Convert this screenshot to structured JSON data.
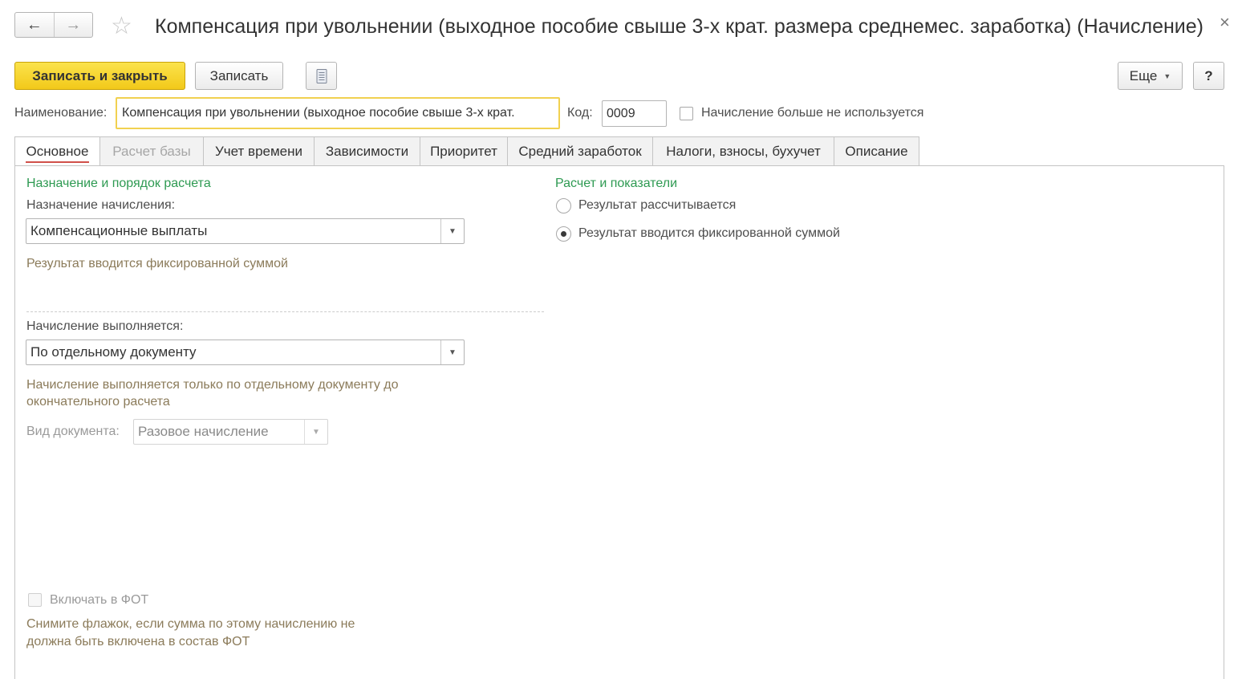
{
  "header": {
    "title": "Компенсация при увольнении (выходное пособие свыше 3-х крат. размера среднемес. заработка) (Начисление)",
    "back_icon": "←",
    "forward_icon": "→",
    "favorite_icon": "☆",
    "close_icon": "×"
  },
  "toolbar": {
    "save_close_label": "Записать и закрыть",
    "save_label": "Записать",
    "more_label": "Еще",
    "help_label": "?"
  },
  "fields": {
    "name_label": "Наименование:",
    "name_value": "Компенсация при увольнении (выходное пособие свыше 3-х крат.",
    "code_label": "Код:",
    "code_value": "0009",
    "unused_label": "Начисление больше не используется"
  },
  "tabs": [
    {
      "label": "Основное"
    },
    {
      "label": "Расчет базы"
    },
    {
      "label": "Учет времени"
    },
    {
      "label": "Зависимости"
    },
    {
      "label": "Приоритет"
    },
    {
      "label": "Средний заработок"
    },
    {
      "label": "Налоги, взносы, бухучет"
    },
    {
      "label": "Описание"
    }
  ],
  "main": {
    "group_left_title": "Назначение и порядок расчета",
    "purpose_label": "Назначение начисления:",
    "purpose_value": "Компенсационные выплаты",
    "purpose_note": "Результат вводится фиксированной суммой",
    "execution_label": "Начисление выполняется:",
    "execution_value": "По отдельному документу",
    "execution_note_line1": "Начисление выполняется только по отдельному документу до",
    "execution_note_line2": "окончательного расчета",
    "doc_type_label": "Вид документа:",
    "doc_type_value": "Разовое начисление",
    "include_fot_label": "Включать в ФОТ",
    "fot_note_line1": "Снимите флажок, если сумма по этому начислению не",
    "fot_note_line2": "должна быть включена в состав ФОТ",
    "group_right_title": "Расчет и показатели",
    "radio_calculated": "Результат рассчитывается",
    "radio_fixed": "Результат вводится фиксированной суммой"
  },
  "colors": {
    "accent_button": "#f2c91a",
    "group_title": "#2e9a52",
    "note_text": "#8b7b5a",
    "active_tab_underline": "#d0504a",
    "focus_border": "#f1d150"
  }
}
